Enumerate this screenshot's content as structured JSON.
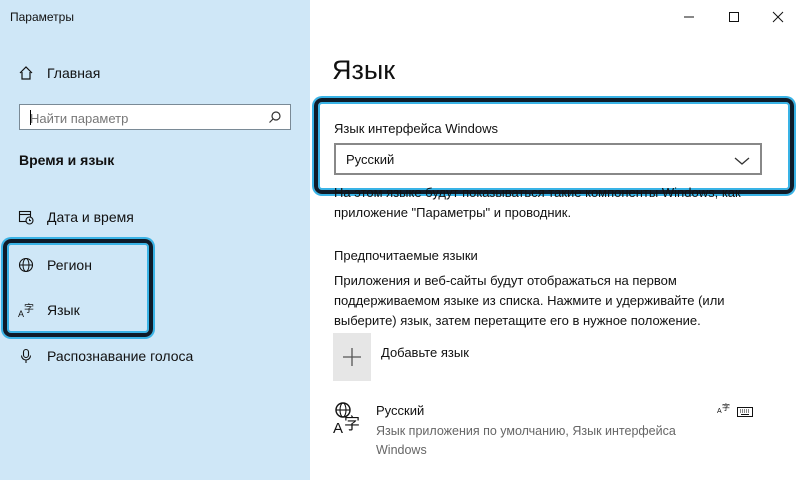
{
  "window": {
    "title": "Параметры"
  },
  "sidebar": {
    "home_label": "Главная",
    "search_placeholder": "Найти параметр",
    "section_title": "Время и язык",
    "items": [
      {
        "label": "Дата и время",
        "icon": "calendar-clock-icon"
      },
      {
        "label": "Регион",
        "icon": "globe-icon"
      },
      {
        "label": "Язык",
        "icon": "language-icon"
      },
      {
        "label": "Распознавание голоса",
        "icon": "microphone-icon"
      }
    ]
  },
  "main": {
    "title": "Язык",
    "display_language": {
      "label": "Язык интерфейса Windows",
      "selected": "Русский",
      "description_line1": "На этом языке будут показываться такие компоненты Windows, как",
      "description_line2": "приложение \"Параметры\" и проводник."
    },
    "preferred": {
      "title": "Предпочитаемые языки",
      "desc_line1": "Приложения и веб-сайты будут отображаться на первом",
      "desc_line2": "поддерживаемом языке из списка. Нажмите и удерживайте (или",
      "desc_line3": "выберите) язык, затем перетащите его в нужное положение.",
      "add_label": "Добавьте язык",
      "languages": [
        {
          "name": "Русский",
          "sub_line1": "Язык приложения по умолчанию, Язык интерфейса",
          "sub_line2": "Windows"
        }
      ]
    }
  },
  "colors": {
    "sidebar_bg": "#cfe7f7",
    "highlight": "#39b3e6",
    "highlight_dark": "#0e1c2a"
  }
}
